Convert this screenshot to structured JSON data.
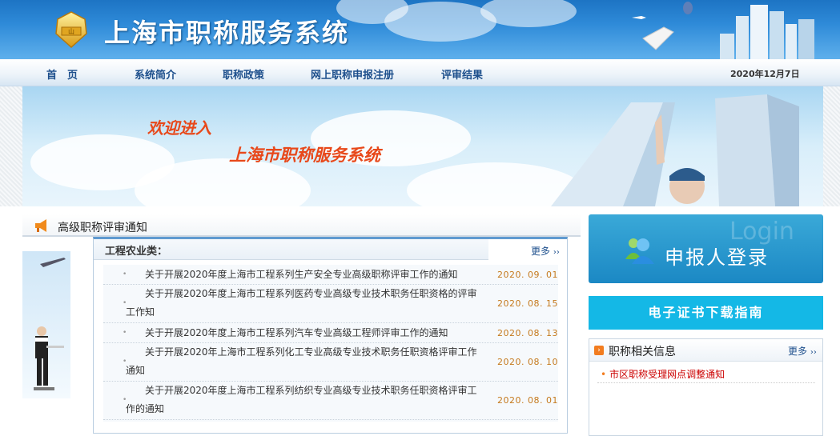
{
  "header": {
    "site_title": "上海市职称服务系统"
  },
  "nav": {
    "items": [
      {
        "label": "首　页"
      },
      {
        "label": "系统简介"
      },
      {
        "label": "职称政策"
      },
      {
        "label": "网上职称申报注册"
      },
      {
        "label": "评审结果"
      }
    ],
    "date": "2020年12月7日"
  },
  "banner": {
    "welcome_line1": "欢迎进入",
    "welcome_line2": "上海市职称服务系统"
  },
  "notices": {
    "section_title": "高级职称评审通知",
    "category": "工程农业类：",
    "more_label": "更多",
    "items": [
      {
        "title": "关于开展2020年度上海市工程系列生产安全专业高级职称评审工作的通知",
        "date": "2020. 09. 01"
      },
      {
        "title": "关于开展2020年度上海市工程系列医药专业高级专业技术职务任职资格的评审工作知",
        "date": "2020. 08. 15"
      },
      {
        "title": "关于开展2020年度上海市工程系列汽车专业高级工程师评审工作的通知",
        "date": "2020. 08. 13"
      },
      {
        "title": "关于开展2020年上海市工程系列化工专业高级专业技术职务任职资格评审工作通知",
        "date": "2020. 08. 10"
      },
      {
        "title": "关于开展2020年度上海市工程系列纺织专业高级专业技术职务任职资格评审工作的通知",
        "date": "2020. 08. 01"
      }
    ]
  },
  "login": {
    "ghost_text": "Login",
    "label": "申报人登录"
  },
  "cert_guide": {
    "label": "电子证书下载指南"
  },
  "info": {
    "title": "职称相关信息",
    "more_label": "更多",
    "items": [
      {
        "label": "市区职称受理网点调整通知"
      }
    ]
  },
  "colors": {
    "accent_orange": "#e8481a",
    "nav_text": "#1d4f8c",
    "cert_button": "#14b8e6",
    "date_text": "#c57a1e"
  }
}
